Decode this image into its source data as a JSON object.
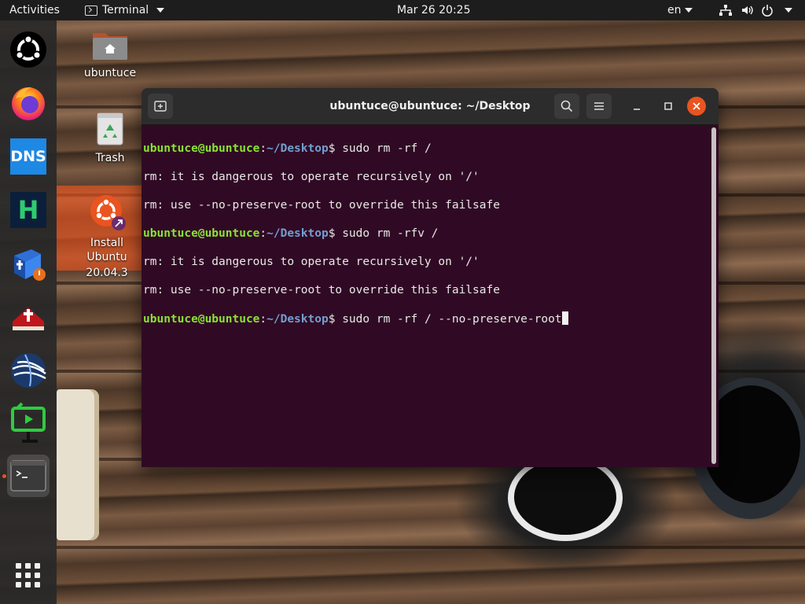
{
  "topbar": {
    "activities": "Activities",
    "app_name": "Terminal",
    "clock": "Mar 26  20:25",
    "language": "en",
    "icons": [
      "network-icon",
      "volume-icon",
      "power-icon"
    ]
  },
  "dock": {
    "items": [
      "ubuntu-logo-icon",
      "firefox-icon",
      "dns-icon",
      "h-app-icon",
      "bible-app-icon",
      "bible-book-icon",
      "globe-app-icon",
      "screen-recorder-icon",
      "terminal-icon",
      "show-apps-icon"
    ],
    "dns_text": "DNS",
    "h_text": "H"
  },
  "desktop": {
    "home_label": "ubuntuce",
    "trash_label": "Trash",
    "install_label_1": "Install Ubuntu",
    "install_label_2": "20.04.3"
  },
  "terminal": {
    "title": "ubuntuce@ubuntuce: ~/Desktop",
    "prompt_user": "ubuntuce@ubuntuce",
    "prompt_sep": ":",
    "prompt_path": "~/Desktop",
    "prompt_dollar": "$ ",
    "cmd1": "sudo rm -rf /",
    "out1": "rm: it is dangerous to operate recursively on '/'",
    "out2": "rm: use --no-preserve-root to override this failsafe",
    "cmd2": "sudo rm -rfv /",
    "out3": "rm: it is dangerous to operate recursively on '/'",
    "out4": "rm: use --no-preserve-root to override this failsafe",
    "cmd3": "sudo rm -rf / --no-preserve-root"
  },
  "colors": {
    "terminal_bg": "#300a24",
    "prompt_user": "#8ae234",
    "prompt_path": "#729fcf",
    "accent": "#e95420"
  }
}
